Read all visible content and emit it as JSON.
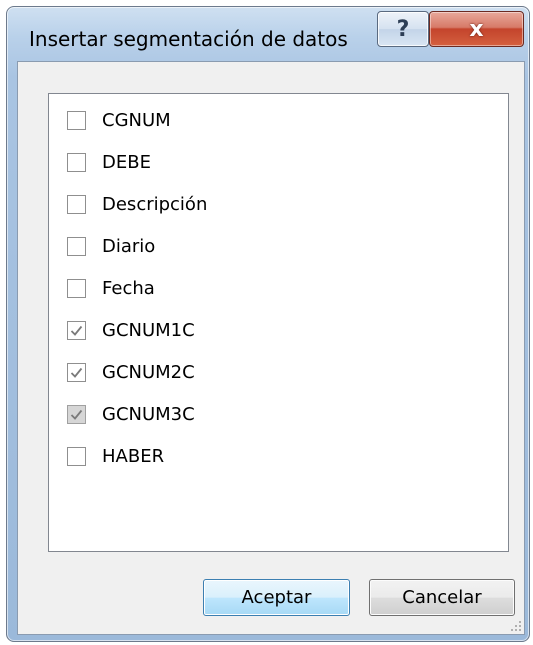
{
  "dialog": {
    "title": "Insertar segmentación de datos",
    "help_glyph": "?",
    "close_glyph": "x"
  },
  "fields": [
    {
      "label": "CGNUM",
      "state": "unchecked"
    },
    {
      "label": "DEBE",
      "state": "unchecked"
    },
    {
      "label": "Descripción",
      "state": "unchecked"
    },
    {
      "label": "Diario",
      "state": "unchecked"
    },
    {
      "label": "Fecha",
      "state": "unchecked"
    },
    {
      "label": "GCNUM1C",
      "state": "checked"
    },
    {
      "label": "GCNUM2C",
      "state": "checked"
    },
    {
      "label": "GCNUM3C",
      "state": "checked-disabled"
    },
    {
      "label": "HABER",
      "state": "unchecked"
    }
  ],
  "buttons": {
    "ok_label": "Aceptar",
    "cancel_label": "Cancelar"
  },
  "colors": {
    "close_button": "#c4442c",
    "default_button_border": "#3c7fb1",
    "check_mark": "#7a7a7a"
  }
}
